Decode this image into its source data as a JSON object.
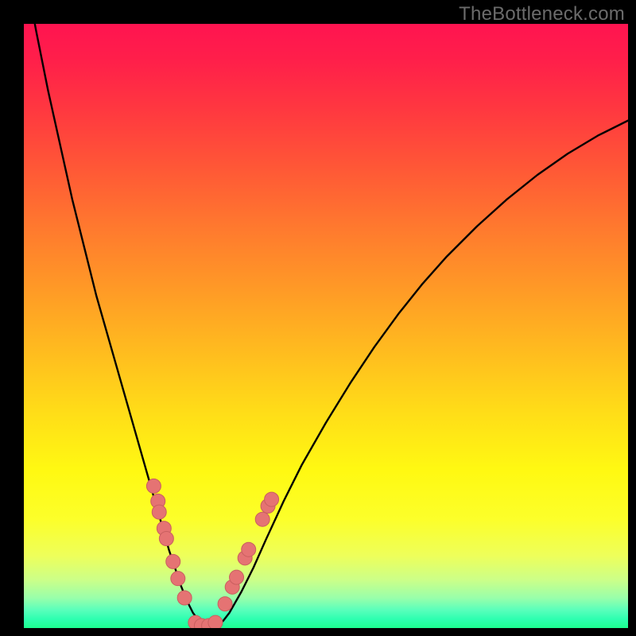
{
  "watermark": "TheBottleneck.com",
  "colors": {
    "frame": "#000000",
    "curve": "#000000",
    "dot_fill": "#e57373",
    "dot_stroke": "#c95f5f"
  },
  "chart_data": {
    "type": "line",
    "title": "",
    "xlabel": "",
    "ylabel": "",
    "xlim": [
      0,
      100
    ],
    "ylim": [
      0,
      100
    ],
    "grid": false,
    "series": [
      {
        "name": "bottleneck-curve",
        "x": [
          0,
          2,
          4,
          6,
          8,
          10,
          12,
          14,
          16,
          18,
          20,
          22,
          24,
          25,
          26,
          27,
          28,
          29,
          30,
          31,
          32,
          33,
          34,
          36,
          38,
          40,
          43,
          46,
          50,
          54,
          58,
          62,
          66,
          70,
          75,
          80,
          85,
          90,
          95,
          100
        ],
        "y": [
          110,
          99,
          89,
          80,
          71,
          63,
          55,
          48,
          41,
          34,
          27,
          20,
          13,
          10,
          7,
          4.5,
          2.5,
          1.2,
          0.4,
          0.1,
          0.4,
          1.2,
          2.5,
          6,
          10,
          14.5,
          21,
          27,
          34,
          40.5,
          46.5,
          52,
          57,
          61.5,
          66.5,
          71,
          75,
          78.5,
          81.5,
          84
        ]
      }
    ],
    "points": [
      {
        "name": "left-cluster",
        "coords": [
          {
            "x": 21.5,
            "y": 23.5
          },
          {
            "x": 22.2,
            "y": 21.0
          },
          {
            "x": 22.4,
            "y": 19.2
          },
          {
            "x": 23.2,
            "y": 16.5
          },
          {
            "x": 23.6,
            "y": 14.8
          },
          {
            "x": 24.7,
            "y": 11.0
          },
          {
            "x": 25.5,
            "y": 8.2
          },
          {
            "x": 26.6,
            "y": 5.0
          }
        ]
      },
      {
        "name": "bottom-cluster",
        "coords": [
          {
            "x": 28.4,
            "y": 0.9
          },
          {
            "x": 29.4,
            "y": 0.4
          },
          {
            "x": 30.6,
            "y": 0.4
          },
          {
            "x": 31.7,
            "y": 0.9
          }
        ]
      },
      {
        "name": "right-cluster",
        "coords": [
          {
            "x": 33.3,
            "y": 4.0
          },
          {
            "x": 34.5,
            "y": 6.8
          },
          {
            "x": 35.2,
            "y": 8.4
          },
          {
            "x": 36.6,
            "y": 11.6
          },
          {
            "x": 37.2,
            "y": 13.0
          },
          {
            "x": 39.5,
            "y": 18.0
          },
          {
            "x": 40.4,
            "y": 20.2
          },
          {
            "x": 41.0,
            "y": 21.3
          }
        ]
      }
    ]
  }
}
